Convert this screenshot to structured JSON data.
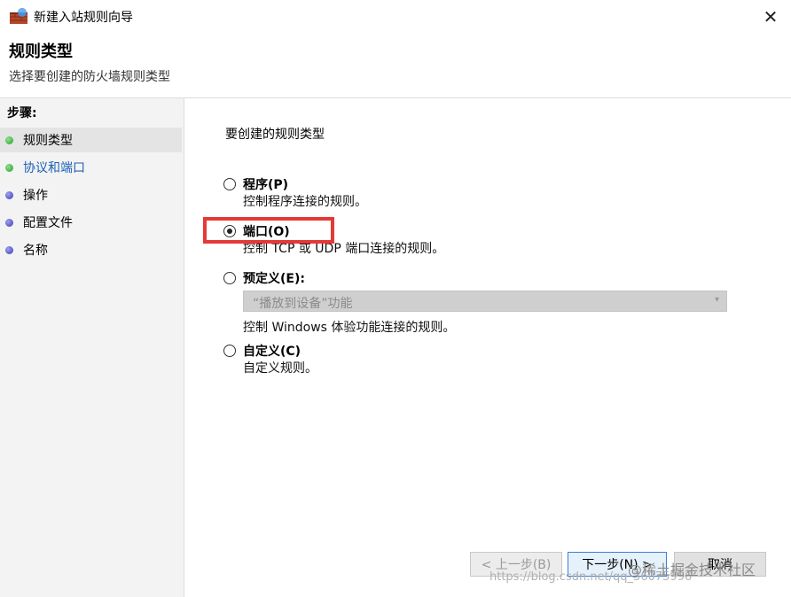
{
  "window": {
    "title": "新建入站规则向导",
    "close_glyph": "✕"
  },
  "header": {
    "title": "规则类型",
    "subtitle": "选择要创建的防火墙规则类型"
  },
  "sidebar": {
    "heading": "步骤:",
    "items": [
      {
        "label": "规则类型",
        "bullet": "green"
      },
      {
        "label": "协议和端口",
        "bullet": "green"
      },
      {
        "label": "操作",
        "bullet": "purple"
      },
      {
        "label": "配置文件",
        "bullet": "purple"
      },
      {
        "label": "名称",
        "bullet": "purple"
      }
    ]
  },
  "main": {
    "question": "要创建的规则类型",
    "options": [
      {
        "label": "程序(P)",
        "desc": "控制程序连接的规则。",
        "checked": false
      },
      {
        "label": "端口(O)",
        "desc": "控制 TCP 或 UDP 端口连接的规则。",
        "checked": true
      },
      {
        "label": "预定义(E):",
        "desc": "控制 Windows 体验功能连接的规则。",
        "checked": false
      },
      {
        "label": "自定义(C)",
        "desc": "自定义规则。",
        "checked": false
      }
    ],
    "predefined_dropdown": {
      "value": "“播放到设备”功能"
    }
  },
  "buttons": {
    "back": "< 上一步(B)",
    "next": "下一步(N) >",
    "cancel": "取消"
  },
  "watermark": {
    "url": "https://blog.csdn.net/qq_36075996",
    "community": "@稀土掘金技术社区"
  },
  "colors": {
    "highlight": "#e53935",
    "link": "#1a5fb4"
  }
}
